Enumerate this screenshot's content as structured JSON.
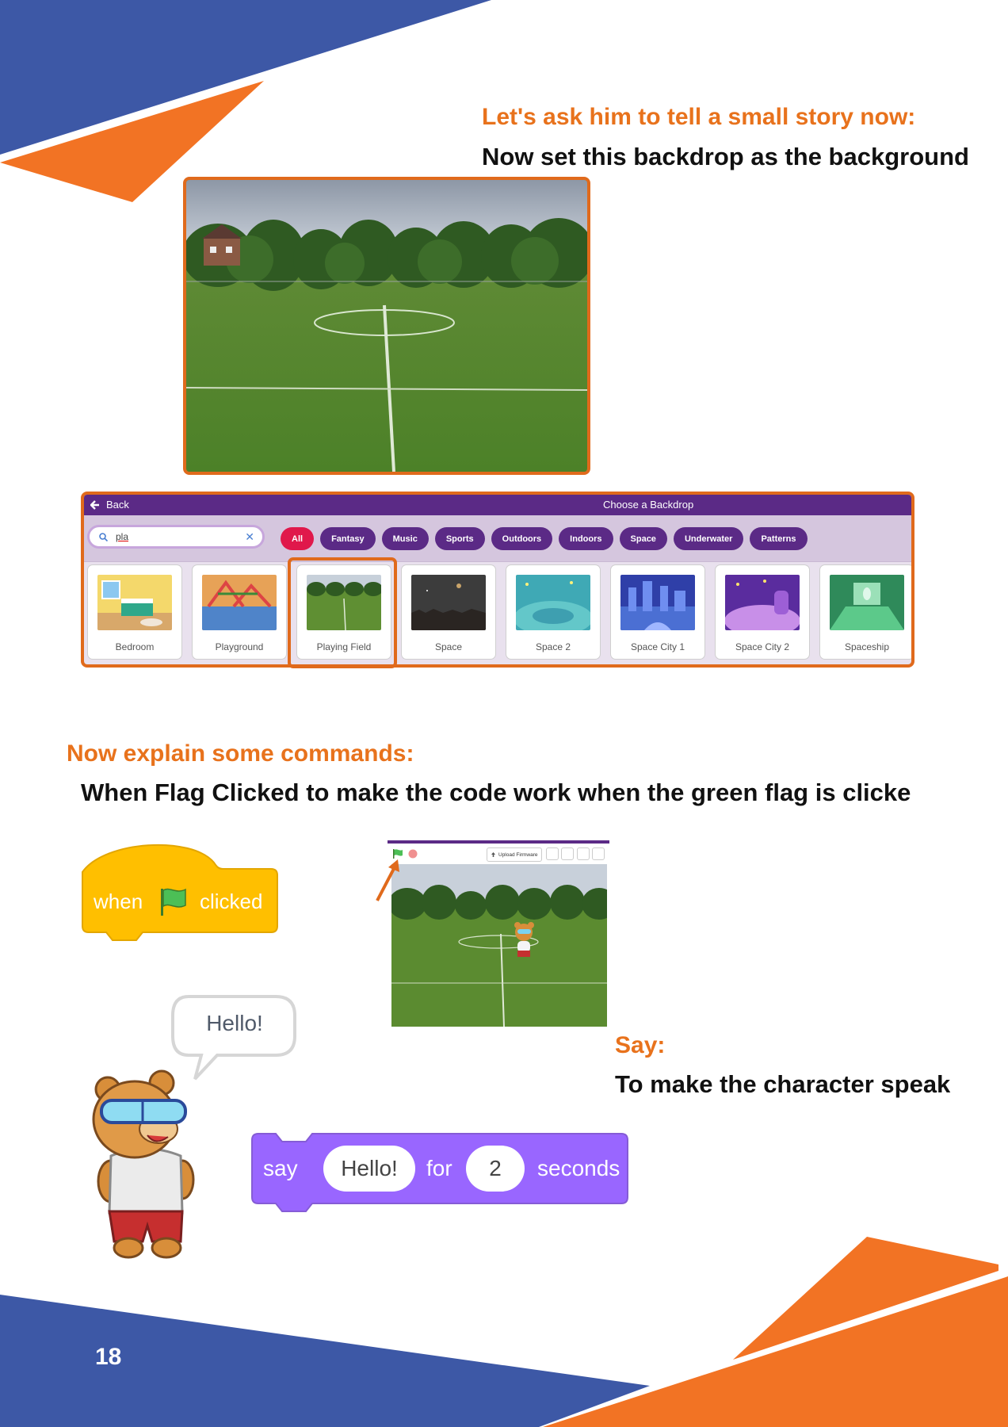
{
  "page": {
    "number": "18",
    "colors": {
      "blue": "#3d58a6",
      "orange": "#f27324",
      "heading_orange": "#e8721c"
    }
  },
  "section1": {
    "heading": "Let's ask him to tell a small story now:",
    "instruction": "Now set this backdrop as the background"
  },
  "backdrop_library": {
    "back_label": "Back",
    "title": "Choose a Backdrop",
    "search": {
      "value": "pla",
      "clear_icon": "close-icon"
    },
    "filters": [
      {
        "label": "All",
        "active": true
      },
      {
        "label": "Fantasy"
      },
      {
        "label": "Music"
      },
      {
        "label": "Sports"
      },
      {
        "label": "Outdoors"
      },
      {
        "label": "Indoors"
      },
      {
        "label": "Space"
      },
      {
        "label": "Underwater"
      },
      {
        "label": "Patterns"
      }
    ],
    "tiles": [
      {
        "label": "Bedroom"
      },
      {
        "label": "Playground"
      },
      {
        "label": "Playing Field",
        "selected": true
      },
      {
        "label": "Space"
      },
      {
        "label": "Space 2"
      },
      {
        "label": "Space City 1"
      },
      {
        "label": "Space City 2"
      },
      {
        "label": "Spaceship"
      }
    ]
  },
  "section2": {
    "heading": "Now explain some commands:",
    "instruction": "When Flag Clicked to make the code work when the green flag is clicke"
  },
  "hat_block": {
    "when": "when",
    "clicked": "clicked",
    "icon": "green-flag-icon"
  },
  "stage": {
    "upload_label": "Upload Firmware"
  },
  "speech_bubble": {
    "text": "Hello!"
  },
  "section3": {
    "heading": "Say:",
    "instruction": "To make the character speak"
  },
  "say_block": {
    "say": "say",
    "message": "Hello!",
    "for": "for",
    "secs": "2",
    "seconds": "seconds"
  }
}
